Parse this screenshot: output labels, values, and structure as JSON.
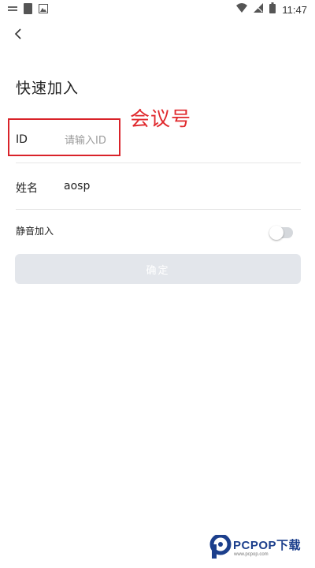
{
  "status_bar": {
    "time": "11:47",
    "icons": [
      "notification-icon",
      "sim-icon",
      "photo-icon",
      "wifi-icon",
      "signal-icon",
      "battery-icon"
    ]
  },
  "header": {
    "back_icon": "chevron-left-icon",
    "title": "快速加入"
  },
  "annotation": {
    "text": "会议号",
    "color": "#e0282c"
  },
  "form": {
    "id_label": "ID",
    "id_placeholder": "请输入ID",
    "id_value": "",
    "name_label": "姓名",
    "name_value": "aosp",
    "mute_label": "静音加入",
    "mute_enabled": false
  },
  "confirm_button": {
    "label": "确定",
    "enabled": false
  },
  "watermark": {
    "text": "PCPOP下载",
    "subtext": "www.pcpop.com"
  },
  "colors": {
    "highlight": "#d9232a",
    "button_disabled": "#e3e6eb",
    "watermark": "#1c3f8c"
  }
}
